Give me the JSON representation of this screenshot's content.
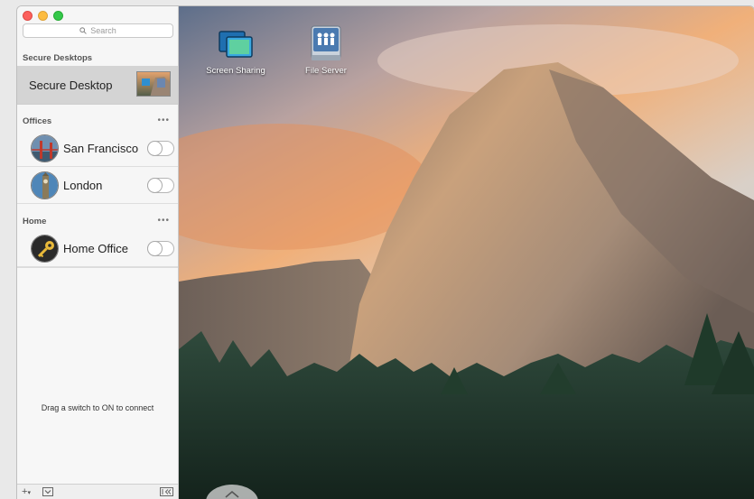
{
  "search": {
    "placeholder": "Search"
  },
  "sections": {
    "secure_desktops": {
      "title": "Secure Desktops",
      "items": [
        {
          "label": "Secure Desktop",
          "selected": true
        }
      ]
    },
    "offices": {
      "title": "Offices",
      "more": "•••",
      "items": [
        {
          "label": "San Francisco",
          "switch": "off"
        },
        {
          "label": "London",
          "switch": "off"
        }
      ]
    },
    "home": {
      "title": "Home",
      "more": "•••",
      "items": [
        {
          "label": "Home Office",
          "switch": "off"
        }
      ]
    }
  },
  "hint": "Drag a switch to ON to connect",
  "toolbar": {
    "add": "+",
    "add_menu": "▾"
  },
  "desktop": {
    "icons": [
      {
        "label": "Screen Sharing",
        "icon": "screen-sharing-icon"
      },
      {
        "label": "File Server",
        "icon": "file-server-icon"
      }
    ]
  },
  "colors": {
    "close": "#fc605c",
    "minimize": "#fdbc40",
    "maximize": "#34c84a"
  }
}
